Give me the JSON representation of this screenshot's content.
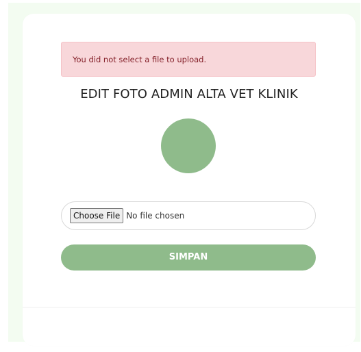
{
  "alert": {
    "message": "You did not select a file to upload."
  },
  "page": {
    "title": "EDIT FOTO ADMIN ALTA VET KLINIK"
  },
  "file_input": {
    "button_label": "Choose File",
    "status_text": "No file chosen"
  },
  "actions": {
    "save_label": "SIMPAN"
  },
  "colors": {
    "accent": "#8fbb8b",
    "alert_bg": "#f8d7da",
    "alert_text": "#842029"
  }
}
